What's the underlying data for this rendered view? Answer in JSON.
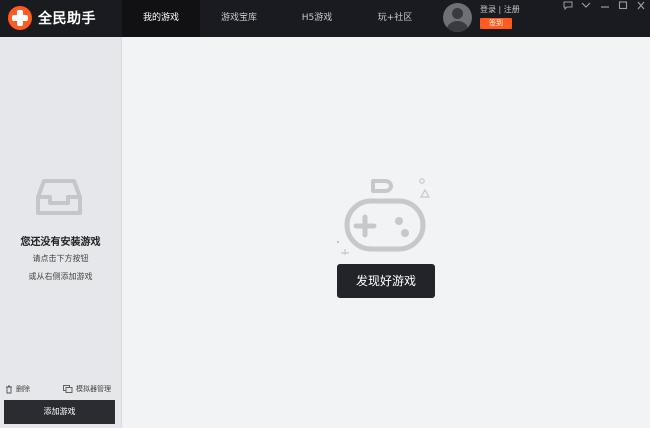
{
  "app": {
    "logo_text": "全民助手"
  },
  "tabs": [
    {
      "label": "我的游戏",
      "active": true
    },
    {
      "label": "游戏宝库",
      "active": false
    },
    {
      "label": "H5游戏",
      "active": false
    },
    {
      "label": "玩+社区",
      "active": false
    }
  ],
  "user": {
    "login_label": "登录 | 注册",
    "signin_label": "签到"
  },
  "window_controls": {
    "feedback_icon": "chat-icon",
    "dropdown_icon": "chevron-down-icon",
    "minimize_icon": "minimize-icon",
    "maximize_icon": "maximize-icon",
    "close_icon": "close-icon"
  },
  "sidebar": {
    "empty_title": "您还没有安装游戏",
    "empty_hint_1": "请点击下方按钮",
    "empty_hint_2": "或从右侧添加游戏",
    "delete_label": "删除",
    "emulator_label": "模拟器管理",
    "add_game_label": "添加游戏"
  },
  "main": {
    "discover_label": "发现好游戏"
  },
  "colors": {
    "topbar": "#1a1b20",
    "accent": "#ff5a1f",
    "button": "#23242a",
    "sidebar": "#e6e7ea",
    "main": "#f2f3f5"
  }
}
